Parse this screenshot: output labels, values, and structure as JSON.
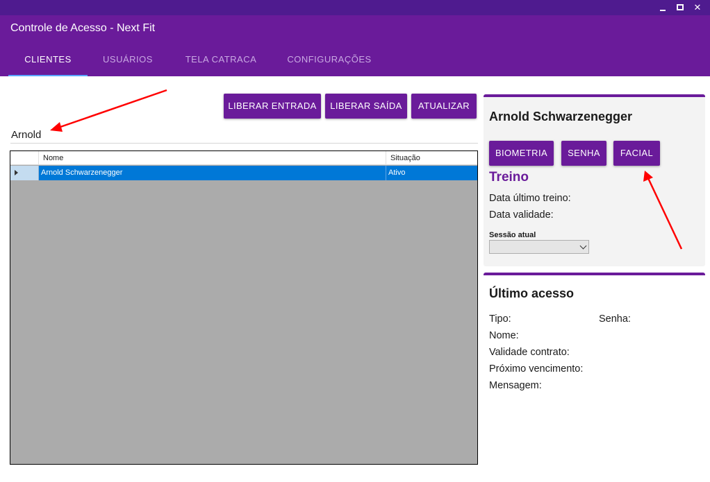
{
  "window": {
    "title": "Controle de Acesso - Next Fit",
    "controls": {
      "minimize": "minimize-icon",
      "maximize": "maximize-icon",
      "close": "✕"
    }
  },
  "tabs": [
    {
      "label": "CLIENTES",
      "active": true
    },
    {
      "label": "USUÁRIOS",
      "active": false
    },
    {
      "label": "TELA CATRACA",
      "active": false
    },
    {
      "label": "CONFIGURAÇÕES",
      "active": false
    }
  ],
  "toolbar": {
    "liberar_entrada": "LIBERAR ENTRADA",
    "liberar_saida": "LIBERAR SAÍDA",
    "atualizar": "ATUALIZAR"
  },
  "search": {
    "value": "Arnold"
  },
  "grid": {
    "columns": [
      "Nome",
      "Situação"
    ],
    "rows": [
      {
        "nome": "Arnold Schwarzenegger",
        "situacao": "Ativo",
        "selected": true
      }
    ]
  },
  "client_panel": {
    "name": "Arnold Schwarzenegger",
    "buttons": {
      "biometria": "BIOMETRIA",
      "senha": "SENHA",
      "facial": "FACIAL"
    },
    "treino_heading": "Treino",
    "data_ultimo_treino_label": "Data último treino:",
    "data_validade_label": "Data validade:",
    "sessao_label": "Sessão atual",
    "sessao_value": ""
  },
  "ultimo_acesso": {
    "heading": "Último acesso",
    "tipo_label": "Tipo:",
    "senha_label": "Senha:",
    "nome_label": "Nome:",
    "validade_label": "Validade contrato:",
    "proximo_label": "Próximo vencimento:",
    "mensagem_label": "Mensagem:"
  },
  "colors": {
    "brand": "#6a1b9a",
    "chrome": "#4f1b8f",
    "tab_indicator": "#5aa6ff",
    "selection": "#0078d7",
    "grid_background": "#ababab",
    "annotation": "#ff0000"
  }
}
